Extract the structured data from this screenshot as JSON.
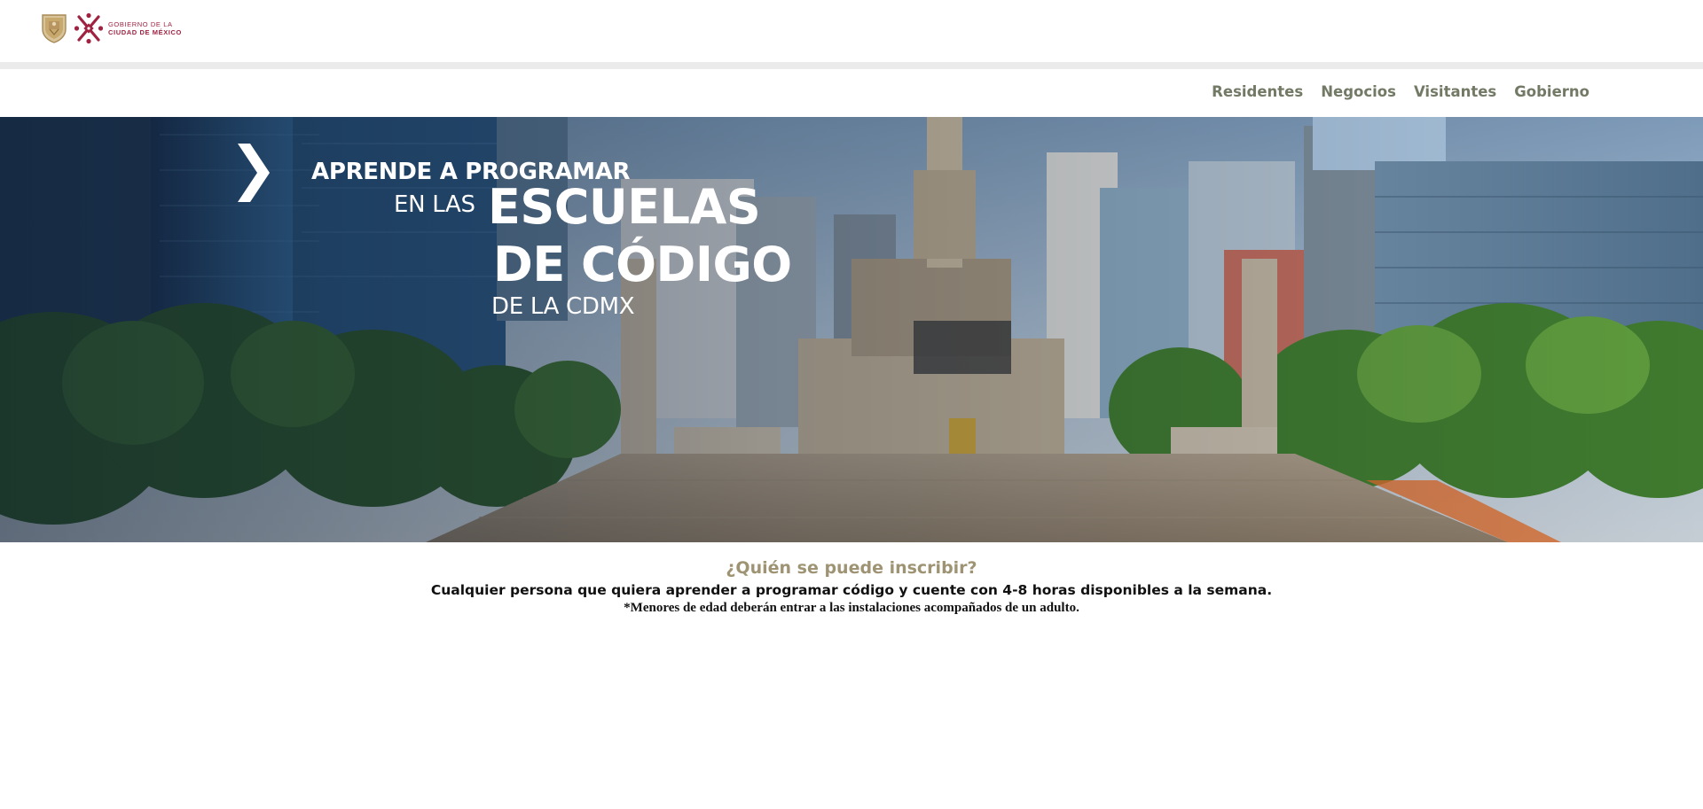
{
  "header": {
    "logo_line1": "GOBIERNO DE LA",
    "logo_line2": "CIUDAD DE MÉXICO",
    "shield_icon": "cdmx-shield-icon",
    "brand_color": "#9f2241"
  },
  "nav": {
    "items": [
      {
        "label": "Residentes"
      },
      {
        "label": "Negocios"
      },
      {
        "label": "Visitantes"
      },
      {
        "label": "Gobierno"
      }
    ],
    "color": "#727965"
  },
  "hero": {
    "line1": "APRENDE A PROGRAMAR",
    "line2": "EN LAS",
    "line3": "ESCUELAS",
    "line4": "DE CÓDIGO",
    "line5": "DE LA CDMX",
    "arrow_icon": "chevron-right-icon",
    "image": "angel-de-la-independencia-photo"
  },
  "info": {
    "question": "¿Quién se puede inscribir?",
    "answer": "Cualquier persona que quiera aprender a programar código y cuente con 4-8 horas disponibles a la semana.",
    "note": "*Menores de edad deberán entrar a las instalaciones acompañados de un adulto.",
    "question_color": "#9e9474"
  }
}
